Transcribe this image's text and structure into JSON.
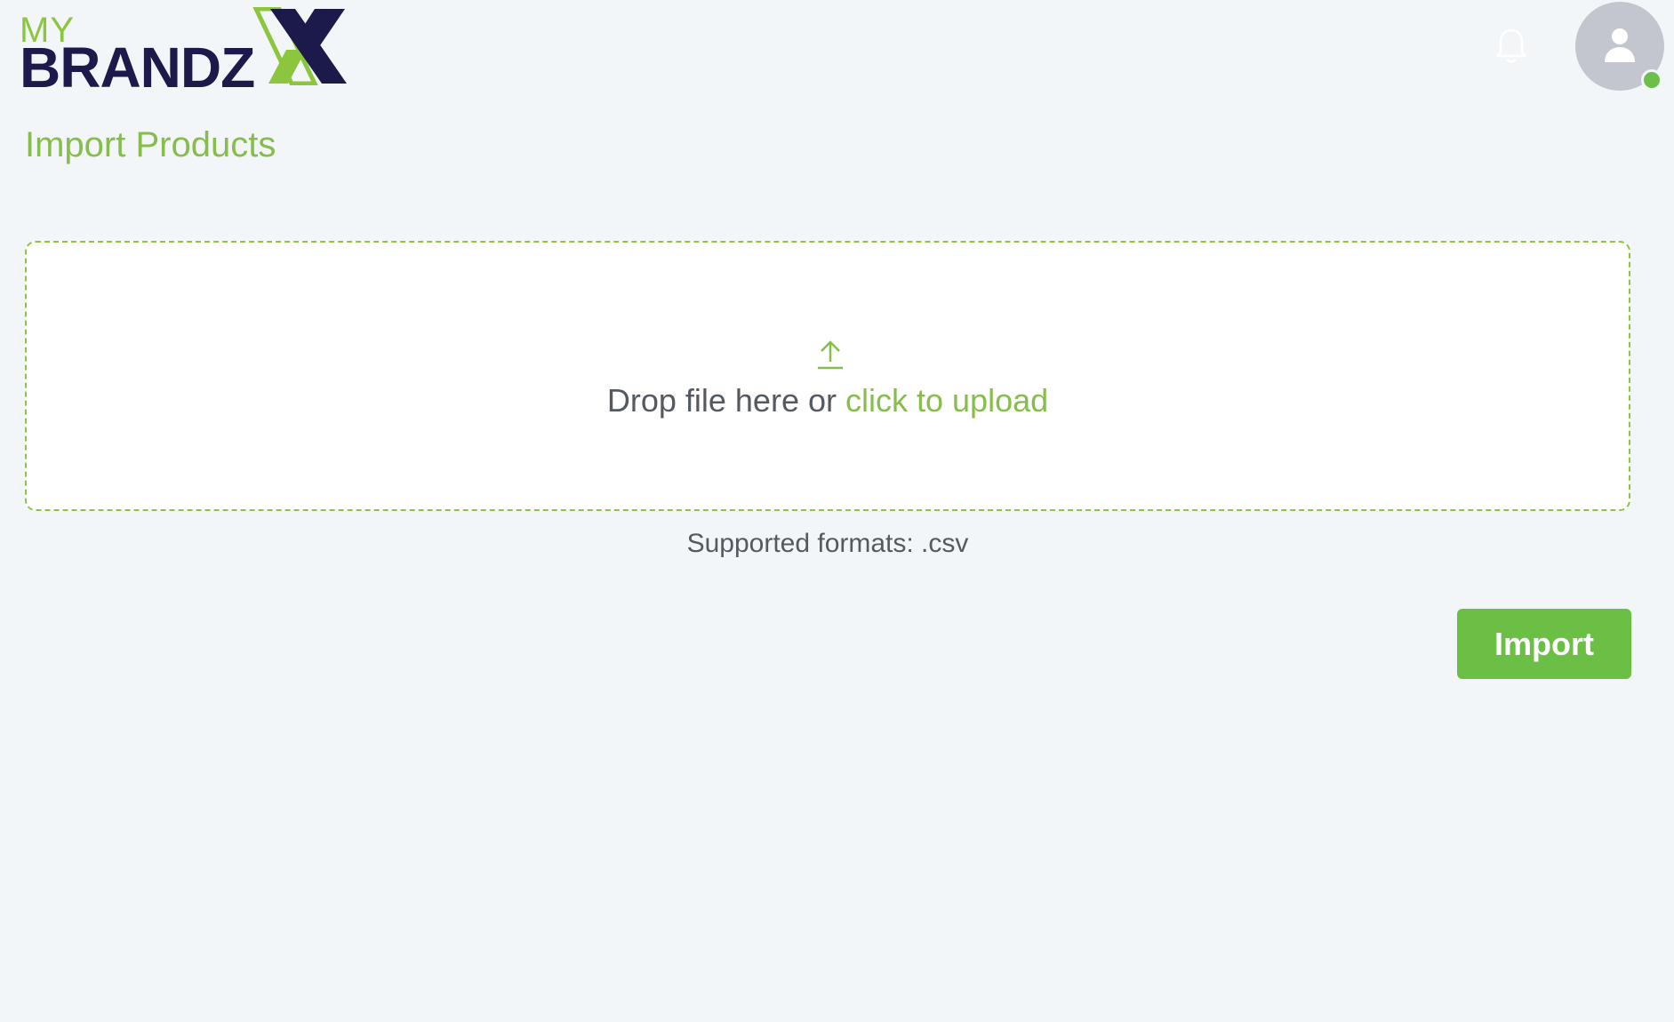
{
  "header": {
    "logo": {
      "my_text": "MY",
      "brand_text": "BRANDZ",
      "brand_color": "#1c1a4a",
      "accent_color": "#8cc63f"
    },
    "notification_icon": "bell-icon",
    "avatar_icon": "user-icon",
    "status": "online",
    "status_color": "#6cc04a"
  },
  "page": {
    "title": "Import Products"
  },
  "upload": {
    "icon": "upload-arrow-icon",
    "prompt": "Drop file here or",
    "link_text": "click to upload",
    "supported_formats": "Supported formats: .csv"
  },
  "actions": {
    "import_label": "Import",
    "import_color": "#6cbf45"
  }
}
